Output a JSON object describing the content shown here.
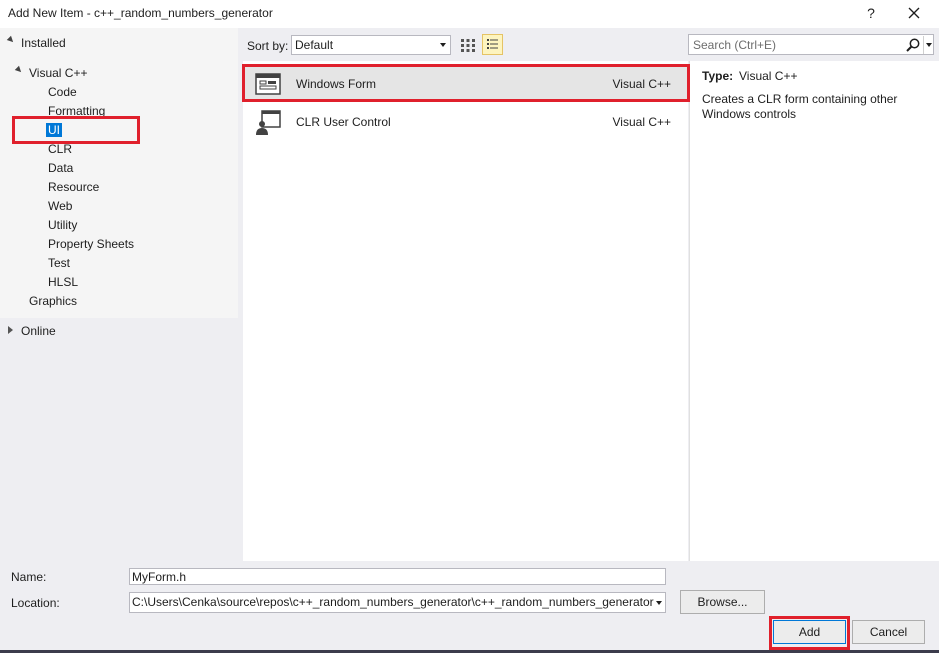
{
  "window": {
    "title": "Add New Item - c++_random_numbers_generator",
    "help_label": "?"
  },
  "tree": {
    "installed_label": "Installed",
    "visual_cpp_label": "Visual C++",
    "children": [
      "Code",
      "Formatting",
      "UI",
      "CLR",
      "Data",
      "Resource",
      "Web",
      "Utility",
      "Property Sheets",
      "Test",
      "HLSL"
    ],
    "graphics_label": "Graphics",
    "online_label": "Online",
    "selected": "UI"
  },
  "toolbar": {
    "sort_label": "Sort by:",
    "sort_value": "Default",
    "search_placeholder": "Search (Ctrl+E)"
  },
  "templates": [
    {
      "name": "Windows Form",
      "language": "Visual C++",
      "selected": true,
      "icon": "windows-form-icon"
    },
    {
      "name": "CLR User Control",
      "language": "Visual C++",
      "selected": false,
      "icon": "user-control-icon"
    }
  ],
  "details": {
    "type_label": "Type:",
    "type_value": "Visual C++",
    "description": "Creates a CLR form containing other Windows controls"
  },
  "form": {
    "name_label": "Name:",
    "name_value": "MyForm.h",
    "location_label": "Location:",
    "location_value": "C:\\Users\\Cenka\\source\\repos\\c++_random_numbers_generator\\c++_random_numbers_generator",
    "browse_label": "Browse...",
    "add_label": "Add",
    "cancel_label": "Cancel"
  },
  "colors": {
    "selection_blue": "#0078d7",
    "highlight_red": "#e0202c",
    "list_view_active": "#fdf4bf"
  }
}
